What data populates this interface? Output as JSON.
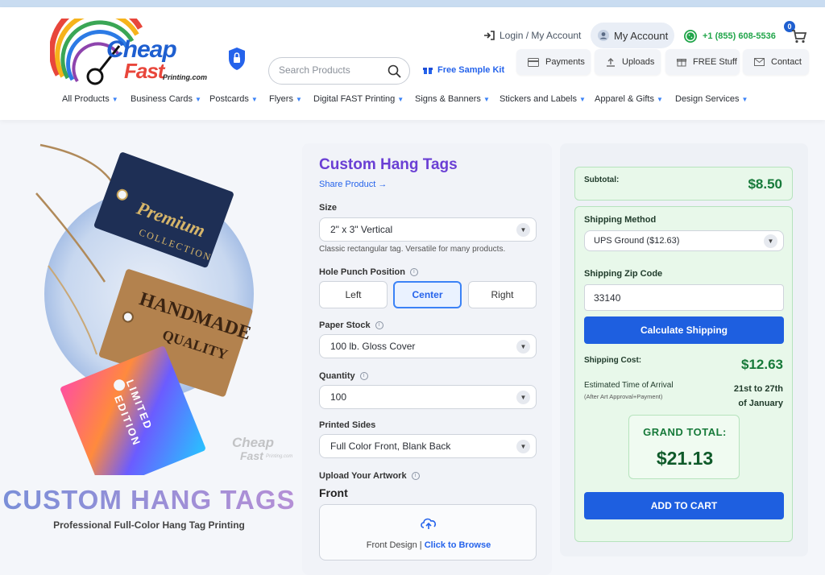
{
  "header": {
    "logo": {
      "word1": "Cheap",
      "word2": "Fast",
      "word3": "Printing.com"
    },
    "search_placeholder": "Search Products",
    "free_sample": "Free Sample Kit",
    "login": "Login / My Account",
    "my_account": "My Account",
    "phone": "+1 (855) 608-5536",
    "cart_count": "0",
    "utility": [
      "Payments",
      "Uploads",
      "FREE Stuff",
      "Contact"
    ]
  },
  "nav": [
    "All Products",
    "Business Cards",
    "Postcards",
    "Flyers",
    "Digital FAST Printing",
    "Signs & Banners",
    "Stickers and Labels",
    "Apparel & Gifts",
    "Design Services"
  ],
  "hero": {
    "tag1_line1": "Premium",
    "tag1_line2": "COLLECTION",
    "tag2_line1": "HANDMADE",
    "tag2_line2": "QUALITY",
    "tag3_line1": "LIMITED",
    "tag3_line2": "EDITION",
    "watermark1": "Cheap",
    "watermark2": "Fast",
    "watermark3": "Printing.com",
    "title": "CUSTOM HANG TAGS",
    "subtitle": "Professional Full-Color Hang Tag Printing"
  },
  "product": {
    "title": "Custom Hang Tags",
    "share": "Share Product →",
    "size_label": "Size",
    "size_value": "2\" x 3\" Vertical",
    "size_hint": "Classic rectangular tag. Versatile for many products.",
    "hole_label": "Hole Punch Position",
    "hole_options": [
      "Left",
      "Center",
      "Right"
    ],
    "hole_selected": "Center",
    "paper_label": "Paper Stock",
    "paper_value": "100 lb. Gloss Cover",
    "qty_label": "Quantity",
    "qty_value": "100",
    "sides_label": "Printed Sides",
    "sides_value": "Full Color Front, Blank Back",
    "upload_label": "Upload Your Artwork",
    "front_label": "Front",
    "upload_text": "Front Design |",
    "upload_link": "Click to Browse"
  },
  "summary": {
    "subtotal_label": "Subtotal:",
    "subtotal": "$8.50",
    "ship_method_label": "Shipping Method",
    "ship_method": "UPS Ground ($12.63)",
    "zip_label": "Shipping Zip Code",
    "zip": "33140",
    "calc_button": "Calculate Shipping",
    "ship_cost_label": "Shipping Cost:",
    "ship_cost": "$12.63",
    "eta_label": "Estimated Time of Arrival",
    "eta_sub": "(After Art Approval+Payment)",
    "eta_line1": "21st to 27th",
    "eta_line2": "of January",
    "grand_label": "GRAND TOTAL:",
    "grand_total": "$21.13",
    "add_to_cart": "ADD TO CART"
  },
  "colors": {
    "accent_blue": "#1e5fe0",
    "green": "#177a3a",
    "purple": "#6a3fd4",
    "whatsapp": "#21a54a"
  }
}
